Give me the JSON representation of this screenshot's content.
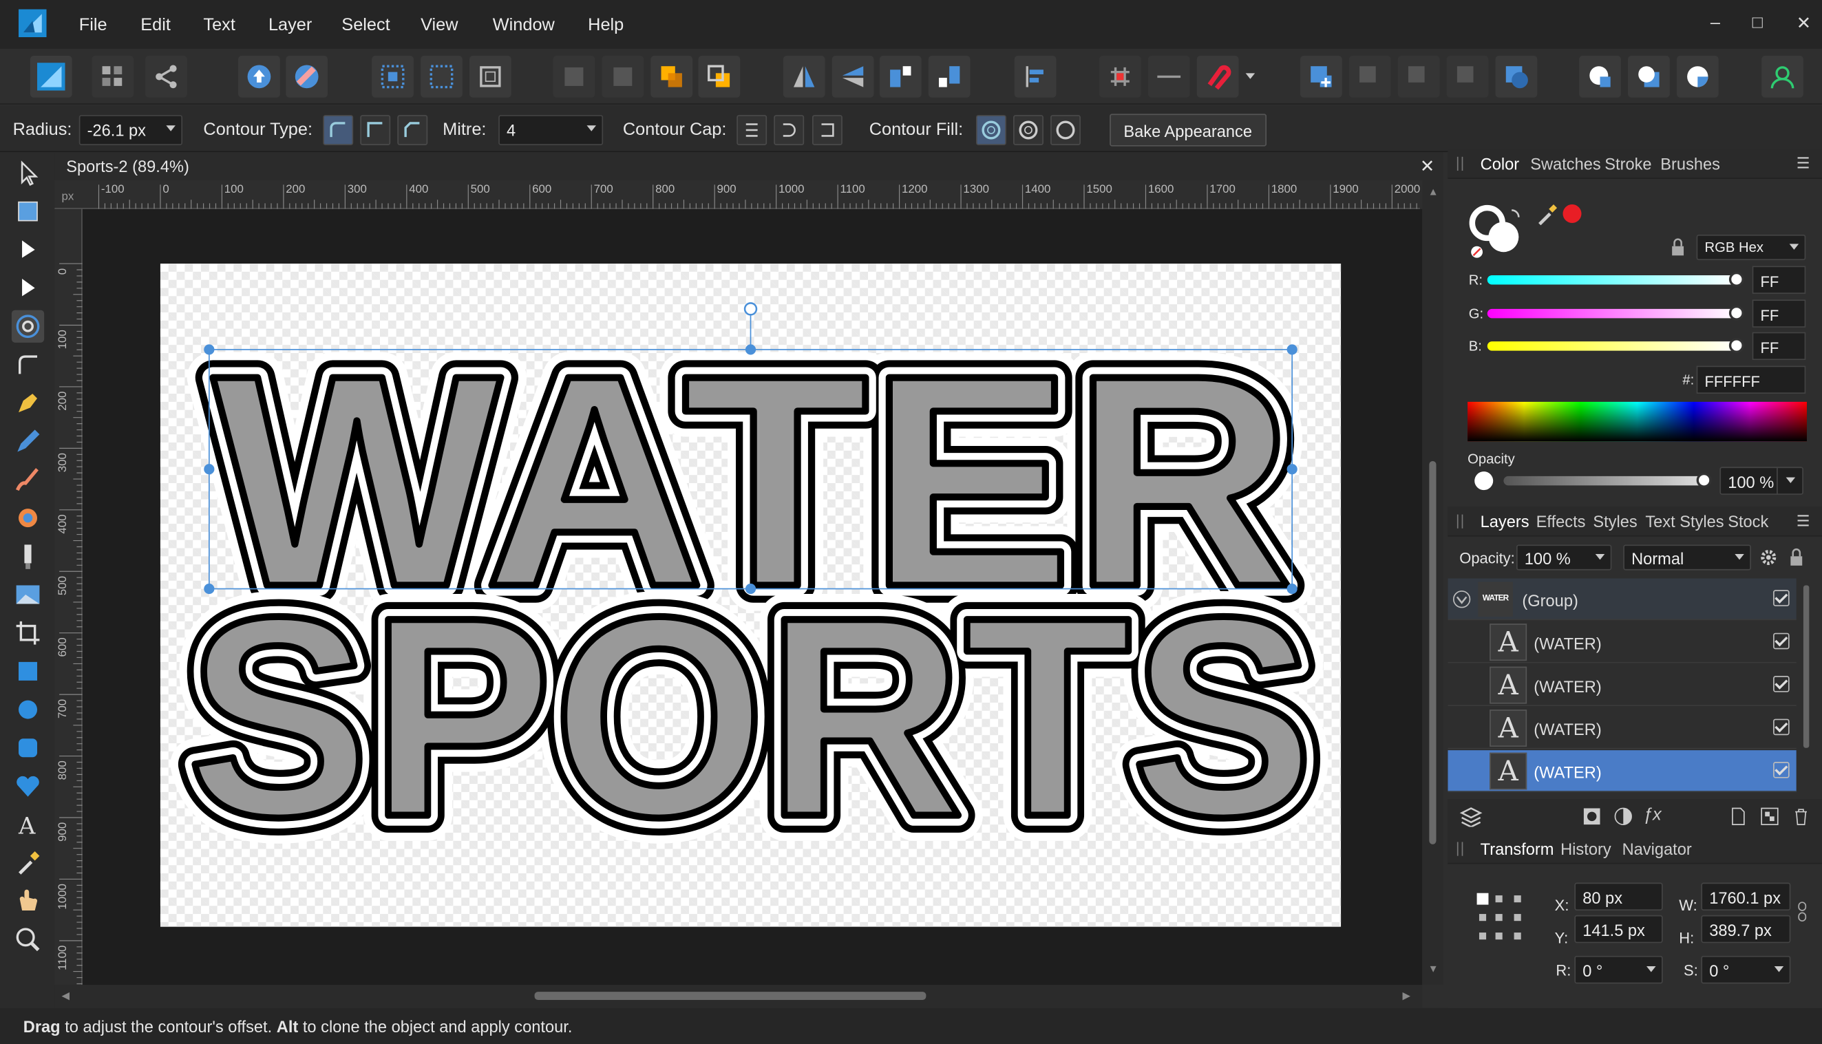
{
  "menu": {
    "items": [
      "File",
      "Edit",
      "Text",
      "Layer",
      "Select",
      "View",
      "Window",
      "Help"
    ]
  },
  "window_controls": {
    "minimize": "–",
    "maximize": "□",
    "close": "✕"
  },
  "context": {
    "radius_label": "Radius:",
    "radius_value": "-26.1 px",
    "contour_type_label": "Contour Type:",
    "mitre_label": "Mitre:",
    "mitre_value": "4",
    "contour_cap_label": "Contour Cap:",
    "contour_fill_label": "Contour Fill:",
    "bake_label": "Bake Appearance"
  },
  "document": {
    "tab_title": "Sports-2 (89.4%)",
    "ruler_unit": "px",
    "h_ticks": [
      "-100",
      "0",
      "100",
      "200",
      "300",
      "400",
      "500",
      "600",
      "700",
      "800",
      "900",
      "1000",
      "1100",
      "1200",
      "1300",
      "1400",
      "1500",
      "1600",
      "1700",
      "1800",
      "1900",
      "2000"
    ],
    "v_ticks": [
      "0",
      "100",
      "200",
      "300",
      "400",
      "500",
      "600",
      "700",
      "800",
      "900",
      "1000",
      "1100"
    ],
    "line1": "WATER",
    "line2": "SPORTS"
  },
  "color_panel": {
    "tabs": [
      "Color",
      "Swatches",
      "Stroke",
      "Brushes"
    ],
    "model": "RGB Hex",
    "r_label": "R:",
    "r_value": "FF",
    "g_label": "G:",
    "g_value": "FF",
    "b_label": "B:",
    "b_value": "FF",
    "hex_label": "#:",
    "hex_value": "FFFFFF",
    "opacity_label": "Opacity",
    "opacity_value": "100 %"
  },
  "layers_panel": {
    "tabs": [
      "Layers",
      "Effects",
      "Styles",
      "Text Styles",
      "Stock"
    ],
    "opacity_label": "Opacity:",
    "opacity_value": "100 %",
    "blend_mode": "Normal",
    "group_thumb": "WATER",
    "group_name": "(Group)",
    "layers": [
      "(WATER)",
      "(WATER)",
      "(WATER)",
      "(WATER)"
    ]
  },
  "transform_panel": {
    "tabs": [
      "Transform",
      "History",
      "Navigator"
    ],
    "x_label": "X:",
    "x_value": "80 px",
    "y_label": "Y:",
    "y_value": "141.5 px",
    "w_label": "W:",
    "w_value": "1760.1 px",
    "h_label": "H:",
    "h_value": "389.7 px",
    "r_label": "R:",
    "r_value": "0 °",
    "s_label": "S:",
    "s_value": "0 °"
  },
  "status": {
    "bold1": "Drag",
    "text1": " to adjust the contour's offset. ",
    "bold2": "Alt",
    "text2": " to clone the object and apply contour."
  },
  "colors": {
    "accent": "#4a90d9",
    "selection_row": "#4a7cc7",
    "red_swatch": "#e81e25"
  }
}
